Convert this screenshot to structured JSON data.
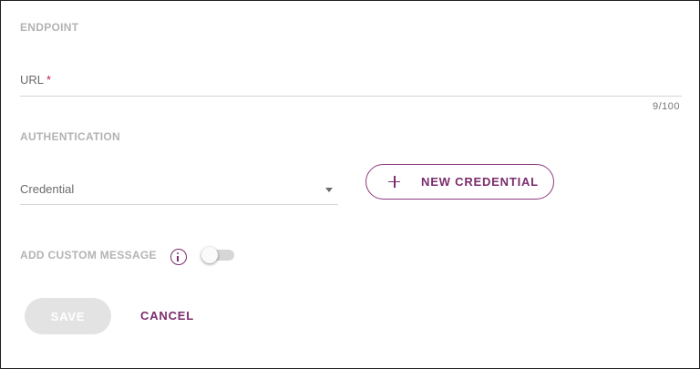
{
  "endpoint": {
    "section_title": "ENDPOINT",
    "url_label": "URL",
    "url_required_mark": "*",
    "url_value": "",
    "url_counter": "9/100"
  },
  "authentication": {
    "section_title": "AUTHENTICATION",
    "credential_label": "Credential",
    "credential_value": "",
    "new_credential_label": "NEW CREDENTIAL"
  },
  "custom_message": {
    "label": "ADD CUSTOM MESSAGE",
    "info_icon": "info-icon",
    "toggle_on": false
  },
  "actions": {
    "save_label": "SAVE",
    "save_enabled": false,
    "cancel_label": "CANCEL"
  },
  "colors": {
    "accent": "#7b2d6d",
    "required": "#c2185b",
    "section_title": "#b3b3b3",
    "disabled_button": "#e3e3e3"
  }
}
